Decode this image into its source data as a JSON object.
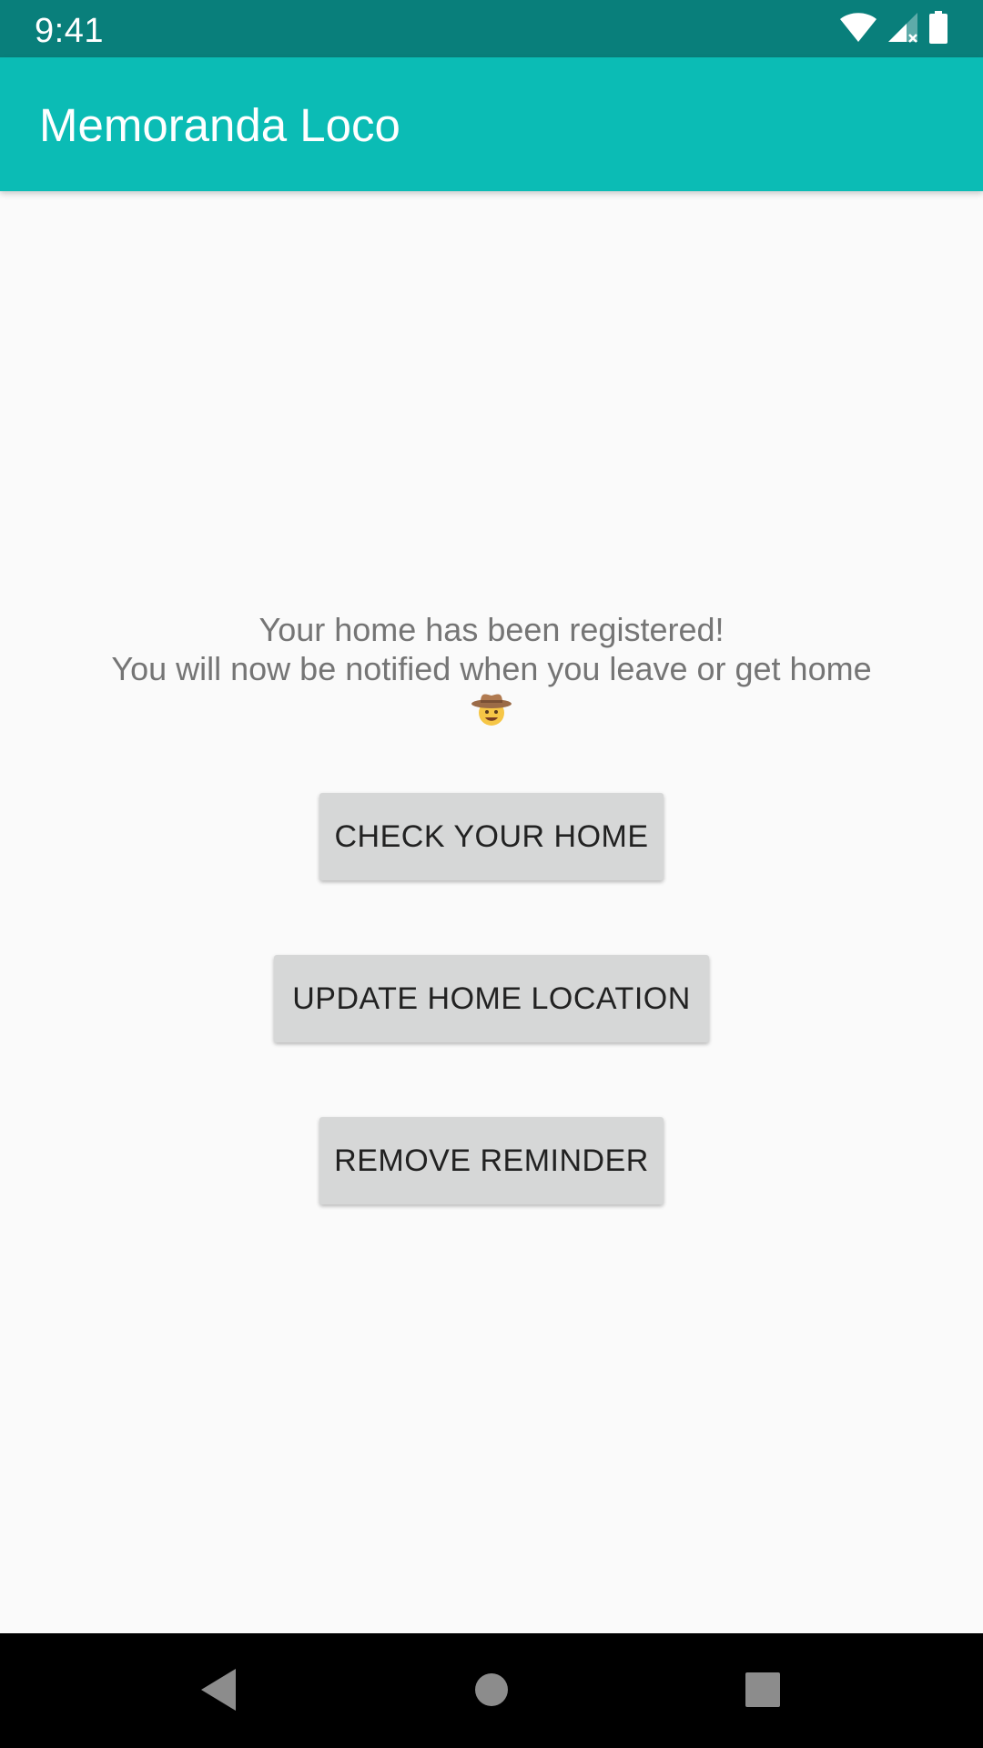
{
  "status_bar": {
    "time": "9:41",
    "icons": [
      "wifi-icon",
      "cell-signal-icon",
      "battery-icon"
    ]
  },
  "app_bar": {
    "title": "Memoranda Loco",
    "color": "#0bbcb5"
  },
  "main": {
    "message_line1": "Your home has been registered!",
    "message_line2": "You will now be notified when you leave or get home",
    "emoji": "cowboy-hat-face-icon",
    "buttons": [
      {
        "label": "CHECK YOUR HOME"
      },
      {
        "label": "UPDATE HOME LOCATION"
      },
      {
        "label": "REMOVE REMINDER"
      }
    ]
  },
  "nav_bar": {
    "icons": [
      "back-icon",
      "home-icon",
      "recents-icon"
    ]
  },
  "colors": {
    "status_bar": "#097f7b",
    "app_bar": "#0bbcb5",
    "background": "#fafafa",
    "button": "#d6d7d7",
    "message_text": "#757575"
  }
}
